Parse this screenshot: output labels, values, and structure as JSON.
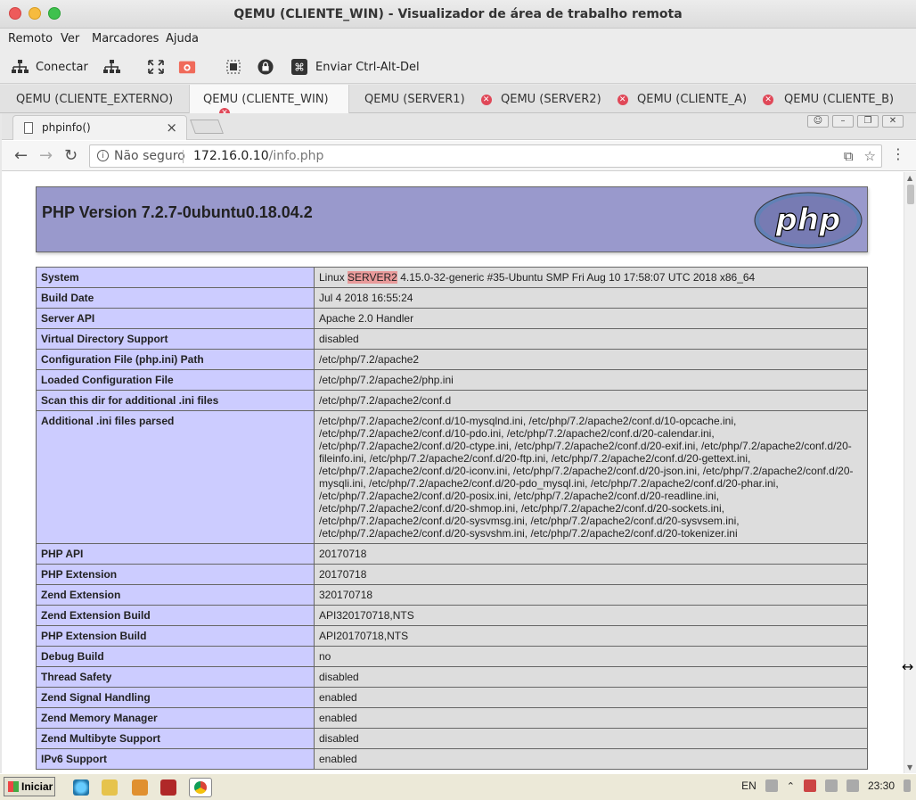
{
  "viewer": {
    "title": "QEMU (CLIENTE_WIN) - Visualizador de área de trabalho remota",
    "menu": [
      "Remoto",
      "Ver",
      "Marcadores",
      "Ajuda"
    ],
    "toolbar": {
      "connect_label": "Conectar",
      "send_cad_label": "Enviar Ctrl-Alt-Del"
    },
    "tabs": [
      {
        "label": "QEMU (CLIENTE_EXTERNO)"
      },
      {
        "label": "QEMU (CLIENTE_WIN)",
        "active": true
      },
      {
        "label": "QEMU (SERVER1)"
      },
      {
        "label": "QEMU (SERVER2)"
      },
      {
        "label": "QEMU (CLIENTE_A)"
      },
      {
        "label": "QEMU (CLIENTE_B)"
      }
    ]
  },
  "browser": {
    "tab_title": "phpinfo()",
    "security_label": "Não seguro",
    "url_host": "172.16.0.10",
    "url_path": "/info.php"
  },
  "php": {
    "version_title": "PHP Version 7.2.7-0ubuntu0.18.04.2",
    "logo_text": "php",
    "system_prefix": "Linux",
    "system_host": "SERVER2",
    "system_suffix": "4.15.0-32-generic #35-Ubuntu SMP Fri Aug 10 17:58:07 UTC 2018 x86_64",
    "rows": [
      {
        "key": "System",
        "value": ""
      },
      {
        "key": "Build Date",
        "value": "Jul 4 2018 16:55:24"
      },
      {
        "key": "Server API",
        "value": "Apache 2.0 Handler"
      },
      {
        "key": "Virtual Directory Support",
        "value": "disabled"
      },
      {
        "key": "Configuration File (php.ini) Path",
        "value": "/etc/php/7.2/apache2"
      },
      {
        "key": "Loaded Configuration File",
        "value": "/etc/php/7.2/apache2/php.ini"
      },
      {
        "key": "Scan this dir for additional .ini files",
        "value": "/etc/php/7.2/apache2/conf.d"
      },
      {
        "key": "Additional .ini files parsed",
        "value": "/etc/php/7.2/apache2/conf.d/10-mysqlnd.ini, /etc/php/7.2/apache2/conf.d/10-opcache.ini,\n/etc/php/7.2/apache2/conf.d/10-pdo.ini, /etc/php/7.2/apache2/conf.d/20-calendar.ini,\n/etc/php/7.2/apache2/conf.d/20-ctype.ini, /etc/php/7.2/apache2/conf.d/20-exif.ini, /etc/php/7.2/apache2/conf.d/20-\nfileinfo.ini, /etc/php/7.2/apache2/conf.d/20-ftp.ini, /etc/php/7.2/apache2/conf.d/20-gettext.ini,\n/etc/php/7.2/apache2/conf.d/20-iconv.ini, /etc/php/7.2/apache2/conf.d/20-json.ini, /etc/php/7.2/apache2/conf.d/20-\nmysqli.ini, /etc/php/7.2/apache2/conf.d/20-pdo_mysql.ini, /etc/php/7.2/apache2/conf.d/20-phar.ini,\n/etc/php/7.2/apache2/conf.d/20-posix.ini, /etc/php/7.2/apache2/conf.d/20-readline.ini,\n/etc/php/7.2/apache2/conf.d/20-shmop.ini, /etc/php/7.2/apache2/conf.d/20-sockets.ini,\n/etc/php/7.2/apache2/conf.d/20-sysvmsg.ini, /etc/php/7.2/apache2/conf.d/20-sysvsem.ini,\n/etc/php/7.2/apache2/conf.d/20-sysvshm.ini, /etc/php/7.2/apache2/conf.d/20-tokenizer.ini"
      },
      {
        "key": "PHP API",
        "value": "20170718"
      },
      {
        "key": "PHP Extension",
        "value": "20170718"
      },
      {
        "key": "Zend Extension",
        "value": "320170718"
      },
      {
        "key": "Zend Extension Build",
        "value": "API320170718,NTS"
      },
      {
        "key": "PHP Extension Build",
        "value": "API20170718,NTS"
      },
      {
        "key": "Debug Build",
        "value": "no"
      },
      {
        "key": "Thread Safety",
        "value": "disabled"
      },
      {
        "key": "Zend Signal Handling",
        "value": "enabled"
      },
      {
        "key": "Zend Memory Manager",
        "value": "enabled"
      },
      {
        "key": "Zend Multibyte Support",
        "value": "disabled"
      },
      {
        "key": "IPv6 Support",
        "value": "enabled"
      }
    ]
  },
  "taskbar": {
    "start_label": "Iniciar",
    "lang": "EN",
    "clock": "23:30"
  },
  "colors": {
    "php_header": "#9999cc",
    "key_cell": "#ccccff",
    "value_cell": "#dddddd",
    "highlight": "#e99a9a",
    "tab_close": "#e04858"
  },
  "icons": [
    "network-icon",
    "fullscreen-icon",
    "screenshot-icon",
    "usb-icon",
    "lock-icon",
    "command-icon",
    "document-icon",
    "info-icon",
    "translate-icon",
    "star-icon",
    "menu-icon"
  ]
}
